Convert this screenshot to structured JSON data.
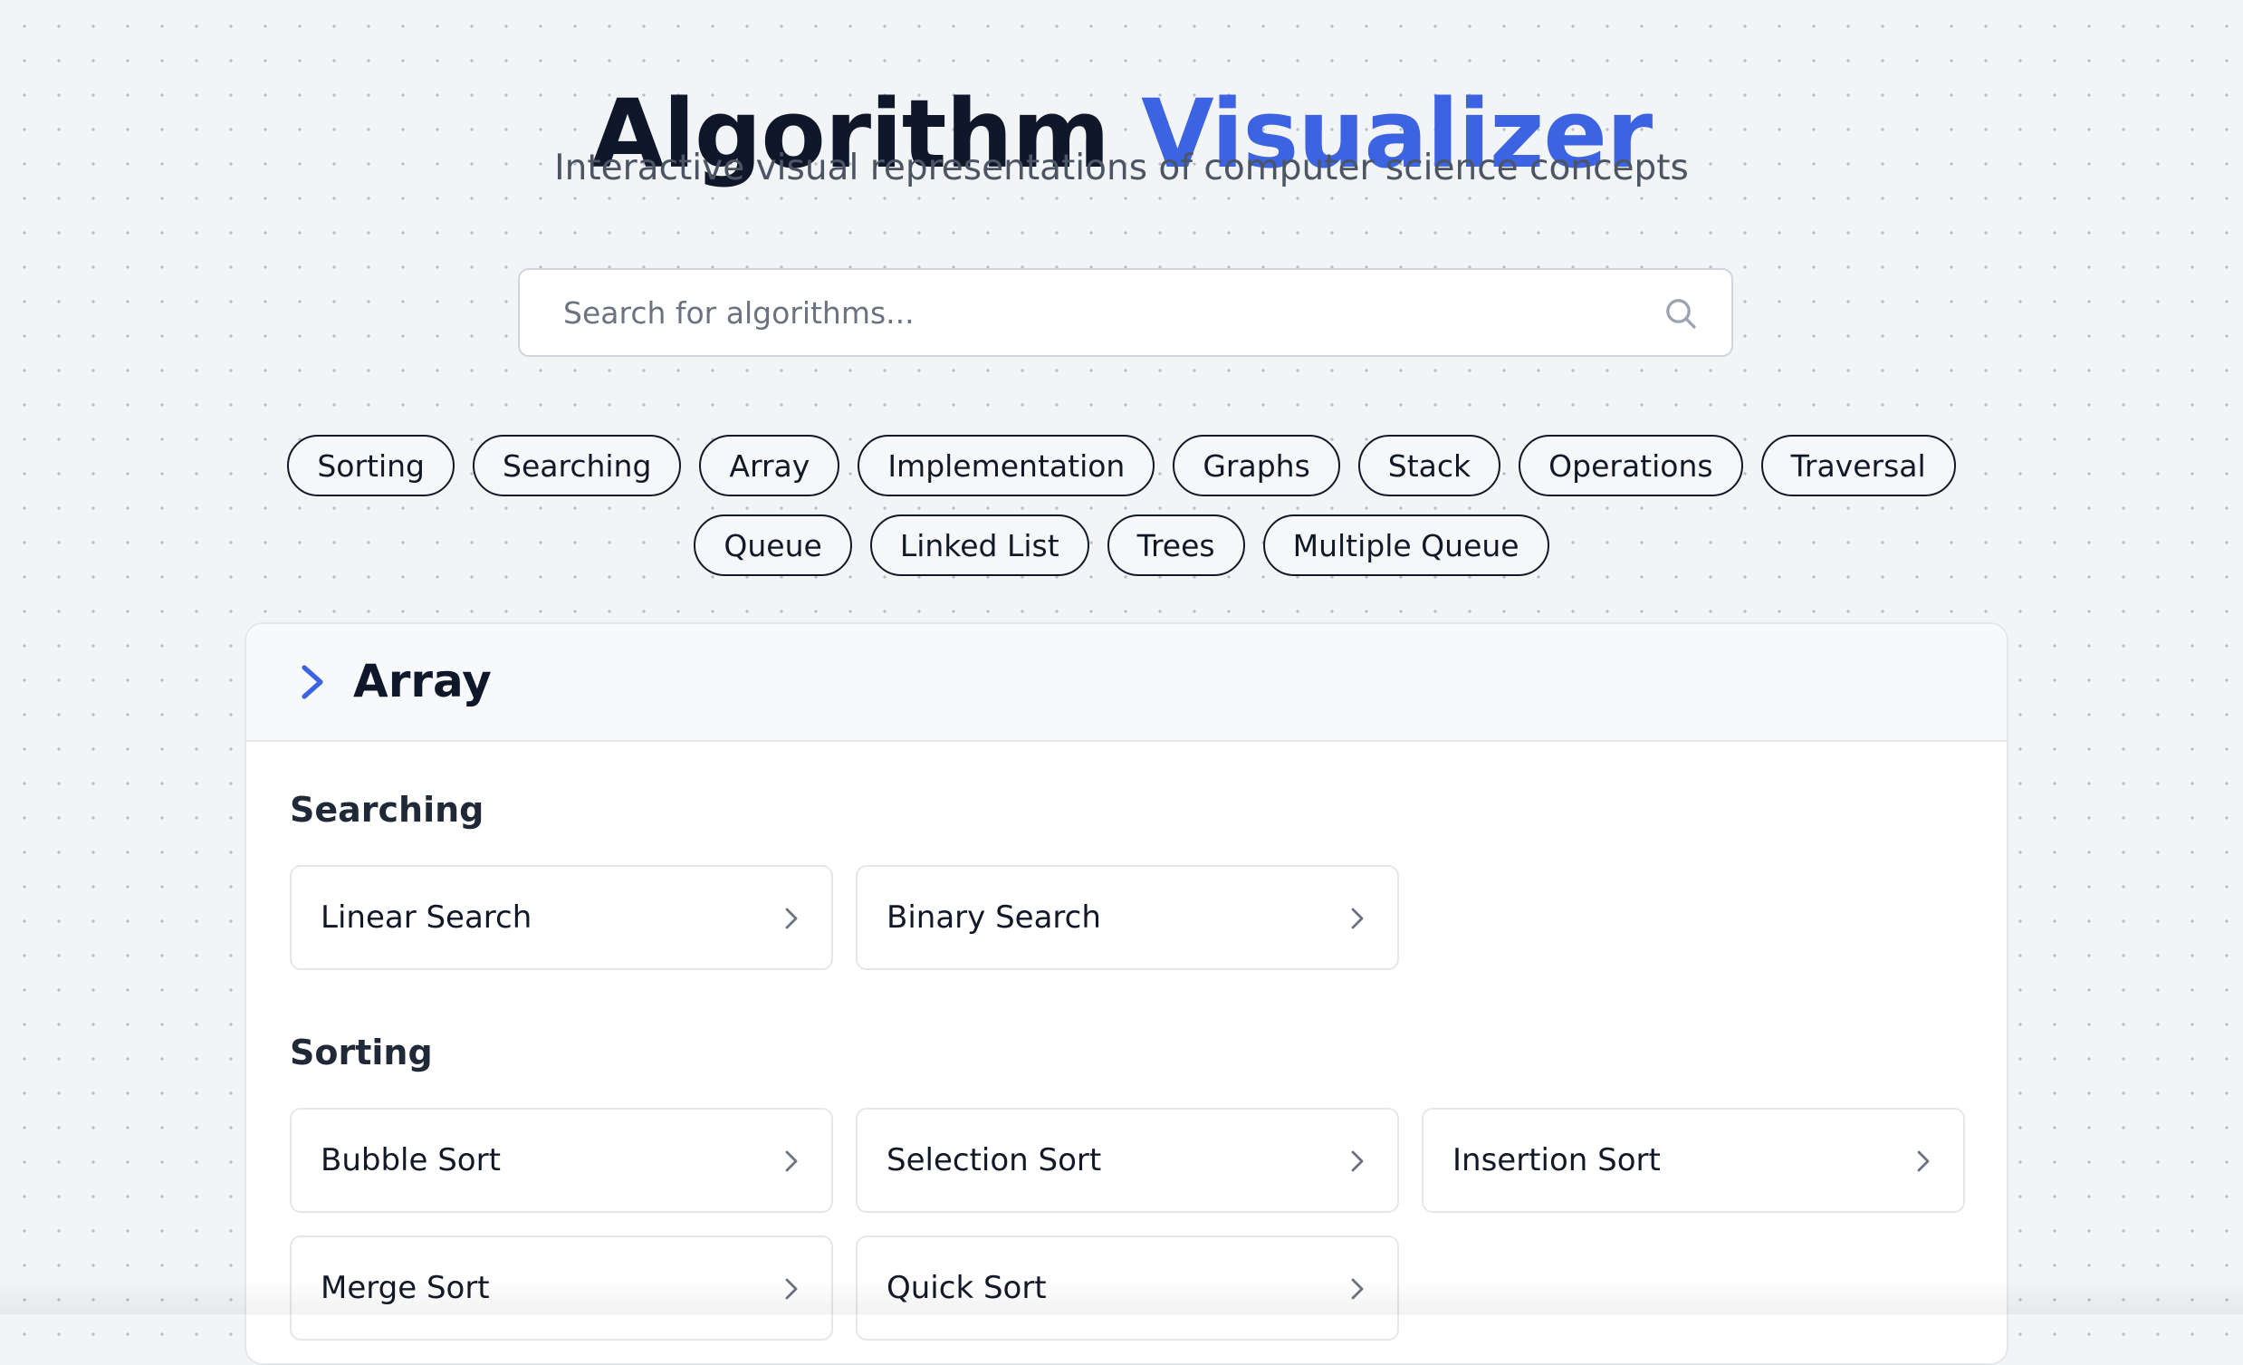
{
  "header": {
    "title_main": "Algorithm",
    "title_accent": "Visualizer",
    "subtitle": "Interactive visual representations of computer science concepts"
  },
  "search": {
    "placeholder": "Search for algorithms...",
    "value": ""
  },
  "tags": [
    "Sorting",
    "Searching",
    "Array",
    "Implementation",
    "Graphs",
    "Stack",
    "Operations",
    "Traversal",
    "Queue",
    "Linked List",
    "Trees",
    "Multiple Queue"
  ],
  "section": {
    "title": "Array",
    "groups": [
      {
        "title": "Searching",
        "items": [
          "Linear Search",
          "Binary Search"
        ]
      },
      {
        "title": "Sorting",
        "items": [
          "Bubble Sort",
          "Selection Sort",
          "Insertion Sort",
          "Merge Sort",
          "Quick Sort"
        ]
      }
    ]
  },
  "colors": {
    "accent": "#3b63e2",
    "title": "#0f172a",
    "background": "#f3f4f6"
  },
  "icons": {
    "search": "search-icon",
    "section_toggle": "chevron-right-icon",
    "card_arrow": "chevron-right-icon"
  }
}
